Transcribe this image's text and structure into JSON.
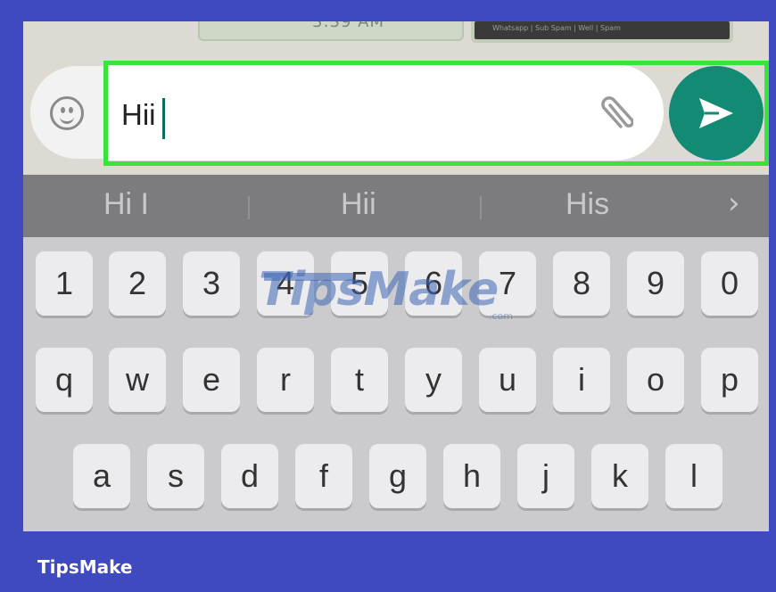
{
  "chat_preview": {
    "time_text": "3:39 AM",
    "strip_text": "Whatsapp  |  Sub Spam  |  Well  |  Spam"
  },
  "composer": {
    "input_value": "Hii"
  },
  "suggestions": [
    "Hi I",
    "Hii",
    "His"
  ],
  "keyboard": {
    "row_numbers": [
      "1",
      "2",
      "3",
      "4",
      "5",
      "6",
      "7",
      "8",
      "9",
      "0"
    ],
    "row_top": [
      "q",
      "w",
      "e",
      "r",
      "t",
      "y",
      "u",
      "i",
      "o",
      "p"
    ],
    "row_middle": [
      "a",
      "s",
      "d",
      "f",
      "g",
      "h",
      "j",
      "k",
      "l"
    ]
  },
  "watermark": {
    "text": "TipsMake",
    "suffix": ".com"
  },
  "brand": "TipsMake",
  "colors": {
    "frame_border": "#3f49c0",
    "highlight": "#38e33c",
    "send_button": "#128a74"
  },
  "icons": {
    "emoji": "smiley-face-icon",
    "attach": "paperclip-icon",
    "send": "send-arrow-icon",
    "more_suggestions": "chevron-right-icon"
  }
}
